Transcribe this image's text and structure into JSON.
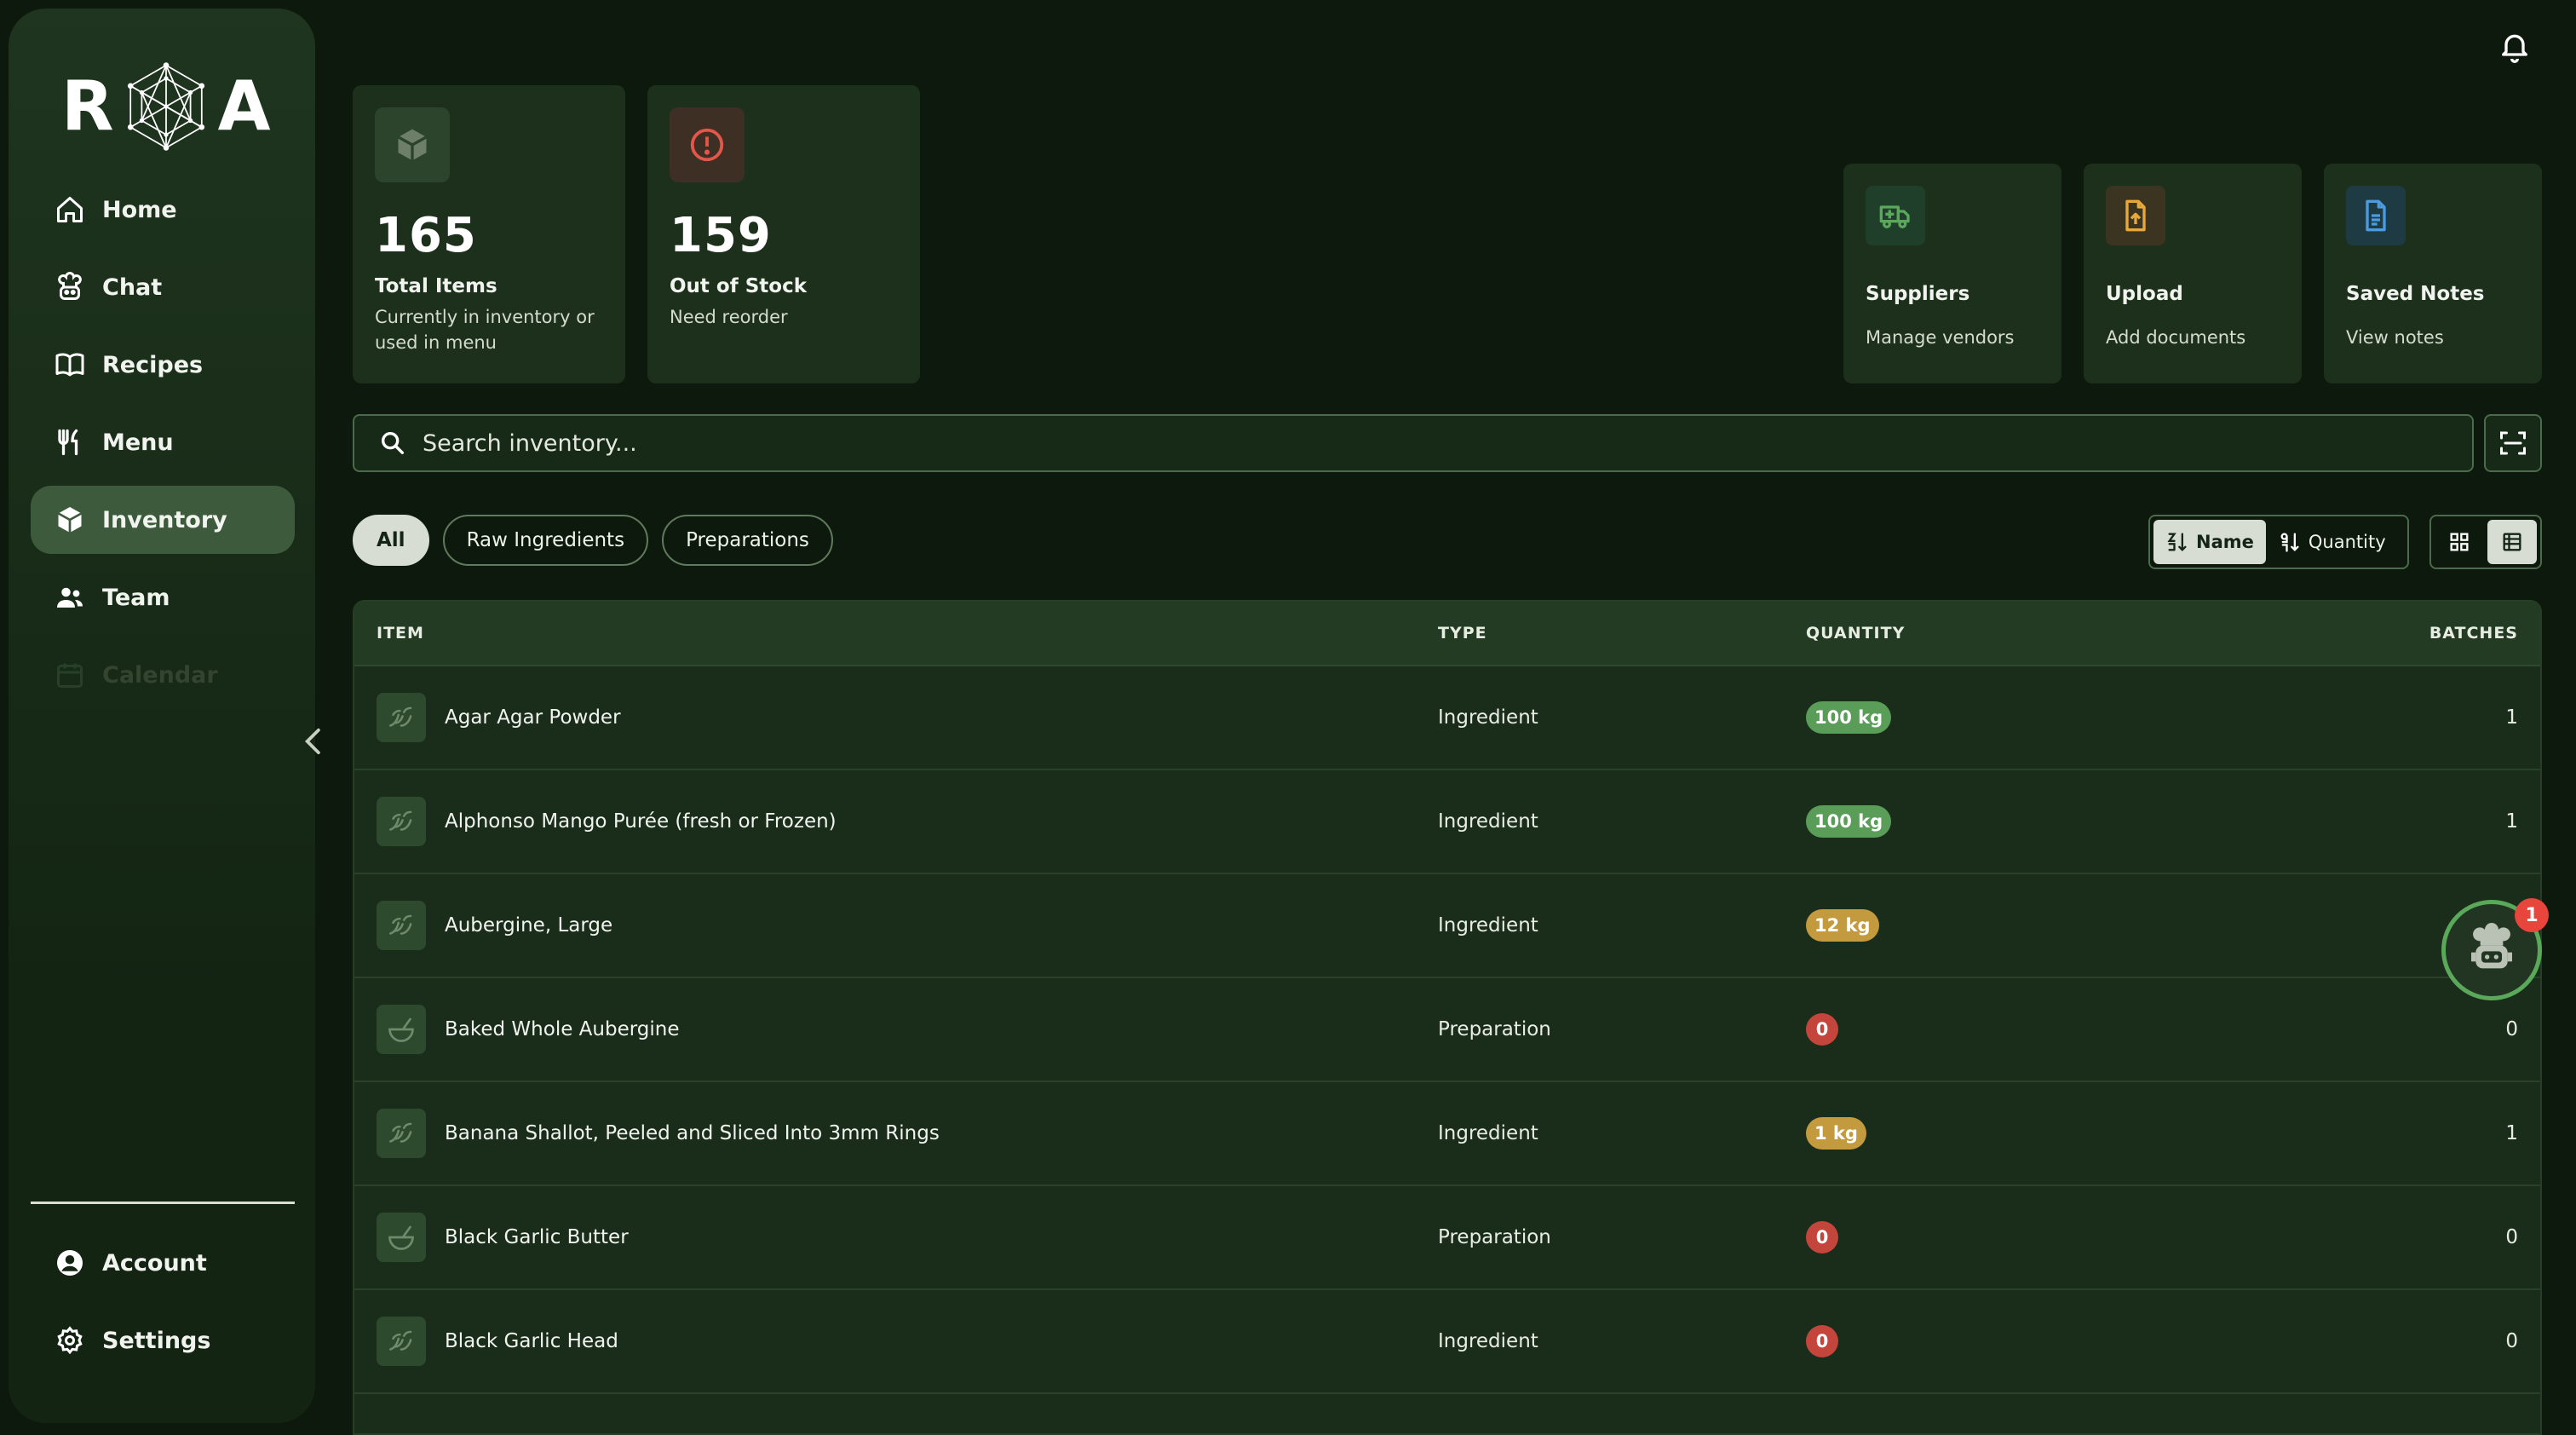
{
  "brand": {
    "letter_left": "R",
    "letter_right": "A"
  },
  "sidebar": {
    "items": [
      {
        "label": "Home",
        "icon": "home-icon"
      },
      {
        "label": "Chat",
        "icon": "chef-icon"
      },
      {
        "label": "Recipes",
        "icon": "book-icon"
      },
      {
        "label": "Menu",
        "icon": "utensils-icon"
      },
      {
        "label": "Inventory",
        "icon": "box-icon",
        "active": true
      },
      {
        "label": "Team",
        "icon": "users-icon"
      },
      {
        "label": "Calendar",
        "icon": "calendar-icon",
        "disabled": true
      }
    ],
    "bottom": [
      {
        "label": "Account",
        "icon": "user-circle-icon"
      },
      {
        "label": "Settings",
        "icon": "gear-icon"
      }
    ]
  },
  "stats": {
    "total": {
      "value": "165",
      "title": "Total Items",
      "sub": "Currently in inventory or used in menu"
    },
    "out": {
      "value": "159",
      "title": "Out of Stock",
      "sub": "Need reorder"
    }
  },
  "actions": {
    "suppliers": {
      "title": "Suppliers",
      "sub": "Manage vendors"
    },
    "upload": {
      "title": "Upload",
      "sub": "Add documents"
    },
    "notes": {
      "title": "Saved Notes",
      "sub": "View notes"
    }
  },
  "search": {
    "placeholder": "Search inventory..."
  },
  "filters": {
    "all": "All",
    "raw": "Raw Ingredients",
    "prep": "Preparations"
  },
  "sort": {
    "name": "Name",
    "quantity": "Quantity"
  },
  "table": {
    "headers": {
      "item": "ITEM",
      "type": "TYPE",
      "quantity": "QUANTITY",
      "batches": "BATCHES"
    },
    "rows": [
      {
        "name": "Agar Agar Powder",
        "type": "Ingredient",
        "qty": "100 kg",
        "status": "green",
        "batches": "1"
      },
      {
        "name": "Alphonso Mango Purée (fresh or Frozen)",
        "type": "Ingredient",
        "qty": "100 kg",
        "status": "green",
        "batches": "1"
      },
      {
        "name": "Aubergine, Large",
        "type": "Ingredient",
        "qty": "12 kg",
        "status": "amber",
        "batches": ""
      },
      {
        "name": "Baked Whole Aubergine",
        "type": "Preparation",
        "qty": "0",
        "status": "red",
        "batches": "0"
      },
      {
        "name": "Banana Shallot, Peeled and Sliced Into 3mm Rings",
        "type": "Ingredient",
        "qty": "1 kg",
        "status": "amber",
        "batches": "1"
      },
      {
        "name": "Black Garlic Butter",
        "type": "Preparation",
        "qty": "0",
        "status": "red",
        "batches": "0"
      },
      {
        "name": "Black Garlic Head",
        "type": "Ingredient",
        "qty": "0",
        "status": "red",
        "batches": "0"
      }
    ]
  },
  "assistant": {
    "badge": "1"
  },
  "colors": {
    "background": "#0c190c",
    "accent_green": "#5a9d58",
    "amber": "#c49a3e",
    "danger": "#c4453c"
  }
}
